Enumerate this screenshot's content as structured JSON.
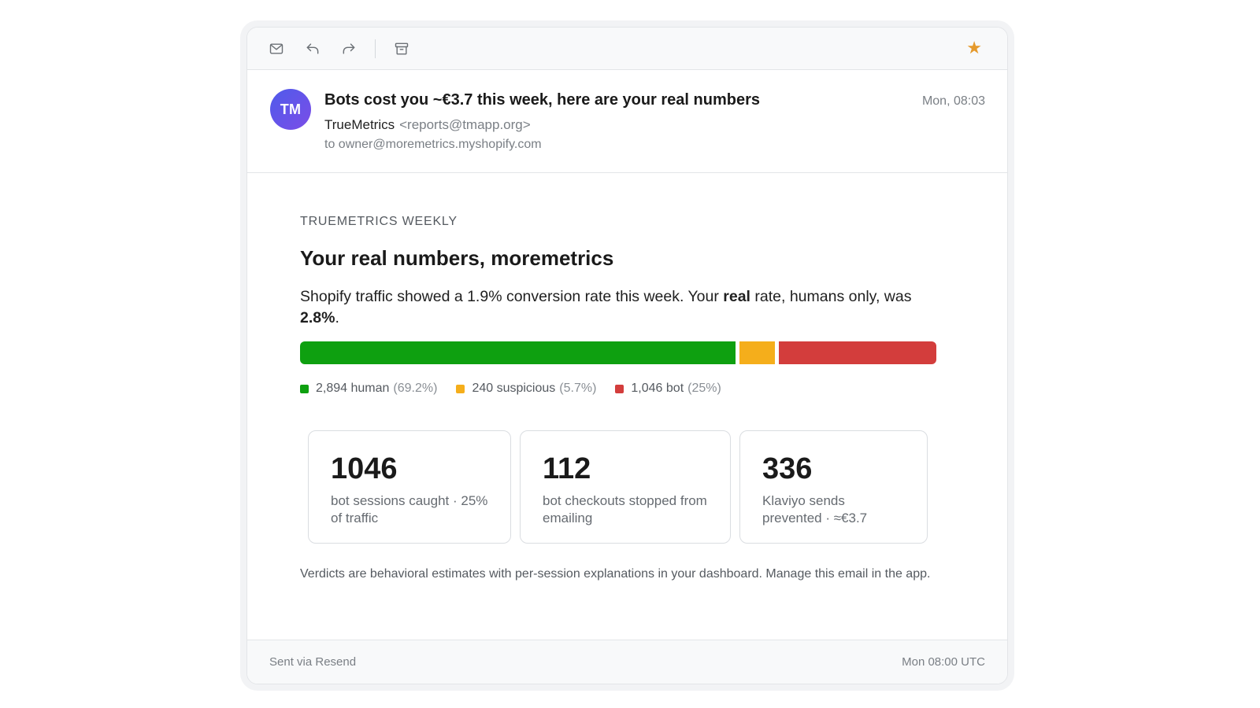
{
  "toolbar": {
    "icons": [
      "mail-icon",
      "reply-icon",
      "forward-icon",
      "archive-icon"
    ],
    "starred": true,
    "star_color": "#e59a2c"
  },
  "email": {
    "avatar_initials": "TM",
    "subject": "Bots cost you ~€3.7 this week, here are your real numbers",
    "date": "Mon, 08:03",
    "from_name": "TrueMetrics",
    "from_address": "<reports@tmapp.org>",
    "to": "to owner@moremetrics.myshopify.com"
  },
  "body": {
    "eyebrow": "TRUEMETRICS WEEKLY",
    "title": "Your real numbers, moremetrics",
    "para_1": "Shopify traffic showed a 1.9% conversion rate this week. Your ",
    "para_bold_1": "real",
    "para_2": " rate, humans only, was ",
    "para_bold_2": "2.8%",
    "para_3": ".",
    "traffic_breakdown": [
      {
        "key": "human",
        "label": "2,894 human",
        "pct_label": "(69.2%)",
        "share": 69.2,
        "color": "#0ea010"
      },
      {
        "key": "suspicious",
        "label": "240 suspicious",
        "pct_label": "(5.7%)",
        "share": 5.7,
        "color": "#f5ae1b"
      },
      {
        "key": "bot",
        "label": "1,046 bot",
        "pct_label": "(25%)",
        "share": 25,
        "color": "#d33d3c"
      }
    ],
    "stats": [
      {
        "number": "1046",
        "label": "bot sessions caught · 25% of traffic"
      },
      {
        "number": "112",
        "label": "bot checkouts stopped from emailing"
      },
      {
        "number": "336",
        "label": "Klaviyo sends prevented · ≈€3.7"
      }
    ],
    "note": "Verdicts are behavioral estimates with per-session explanations in your dashboard. Manage this email in the app."
  },
  "footer": {
    "left": "Sent via Resend",
    "right": "Mon 08:00 UTC"
  }
}
